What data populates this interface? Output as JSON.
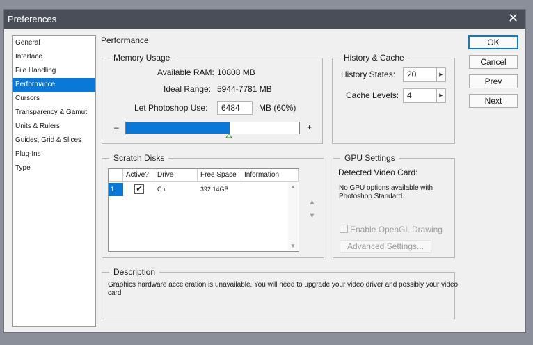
{
  "window": {
    "title": "Preferences"
  },
  "sidebar": {
    "items": [
      {
        "label": "General"
      },
      {
        "label": "Interface"
      },
      {
        "label": "File Handling"
      },
      {
        "label": "Performance",
        "active": true
      },
      {
        "label": "Cursors"
      },
      {
        "label": "Transparency & Gamut"
      },
      {
        "label": "Units & Rulers"
      },
      {
        "label": "Guides, Grid & Slices"
      },
      {
        "label": "Plug-Ins"
      },
      {
        "label": "Type"
      }
    ]
  },
  "panel": {
    "title": "Performance"
  },
  "memory": {
    "legend": "Memory Usage",
    "available_label": "Available RAM:",
    "available_value": "10808 MB",
    "ideal_label": "Ideal Range:",
    "ideal_value": "5944-7781 MB",
    "let_label": "Let Photoshop Use:",
    "let_value": "6484",
    "let_unit": "MB (60%)",
    "minus": "–",
    "plus": "+",
    "slider_fraction": 0.6
  },
  "history": {
    "legend": "History & Cache",
    "states_label": "History States:",
    "states_value": "20",
    "cache_label": "Cache Levels:",
    "cache_value": "4"
  },
  "buttons": {
    "ok": "OK",
    "cancel": "Cancel",
    "prev": "Prev",
    "next": "Next"
  },
  "scratch": {
    "legend": "Scratch Disks",
    "columns": [
      "Active?",
      "Drive",
      "Free Space",
      "Information"
    ],
    "rows": [
      {
        "index": "1",
        "active_mark": "✔",
        "drive": "C:\\",
        "free": "392.14GB",
        "info": ""
      }
    ],
    "move_up": "▲",
    "move_down": "▼"
  },
  "gpu": {
    "legend": "GPU Settings",
    "detected_label": "Detected Video Card:",
    "message": "No GPU options available with Photoshop Standard.",
    "opengl_label": "Enable OpenGL Drawing",
    "advanced_label": "Advanced Settings..."
  },
  "description": {
    "legend": "Description",
    "text": "Graphics hardware acceleration is unavailable. You will need to upgrade your video driver and possibly your video card"
  }
}
